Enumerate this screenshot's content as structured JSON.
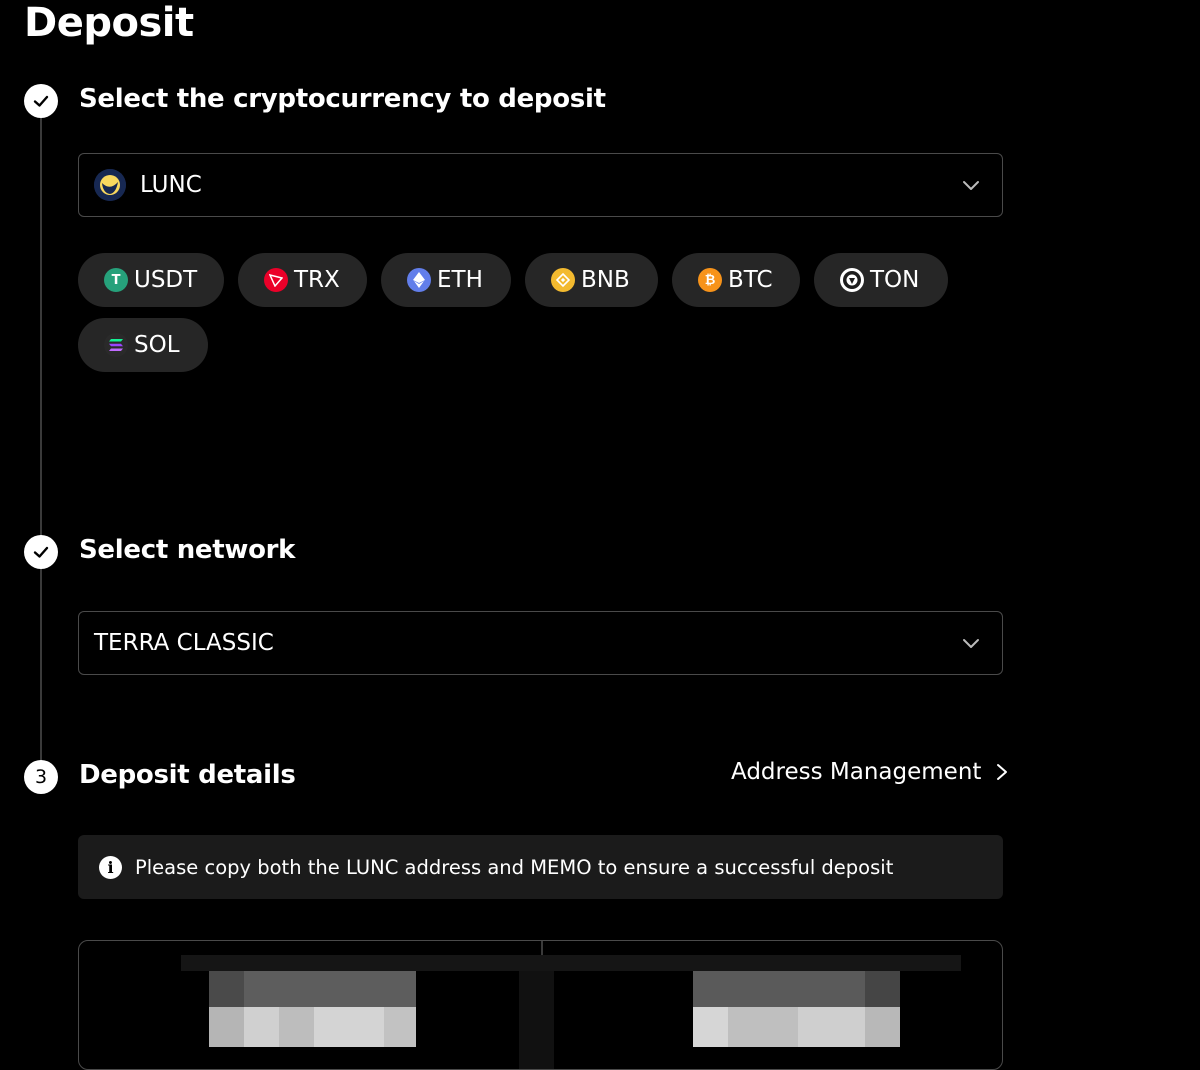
{
  "page": {
    "title": "Deposit"
  },
  "steps": [
    {
      "title": "Select the cryptocurrency to deposit",
      "marker": "check-icon"
    },
    {
      "title": "Select network",
      "marker": "check-icon"
    },
    {
      "title": "Deposit details",
      "marker": "3"
    }
  ],
  "crypto_select": {
    "value": "LUNC",
    "icon": "lunc-coin-icon"
  },
  "quick_coins": [
    {
      "label": "USDT",
      "icon": "usdt-icon",
      "color": "#26a17b"
    },
    {
      "label": "TRX",
      "icon": "trx-icon",
      "color": "#eb0029"
    },
    {
      "label": "ETH",
      "icon": "eth-icon",
      "color": "#627eea"
    },
    {
      "label": "BNB",
      "icon": "bnb-icon",
      "color": "#f3ba2f"
    },
    {
      "label": "BTC",
      "icon": "btc-icon",
      "color": "#f7931a"
    },
    {
      "label": "TON",
      "icon": "ton-icon",
      "color": "#ffffff"
    },
    {
      "label": "SOL",
      "icon": "sol-icon",
      "color": "#9945ff"
    }
  ],
  "network_select": {
    "value": "TERRA CLASSIC"
  },
  "address_management": {
    "label": "Address Management"
  },
  "notice": {
    "text": "Please copy both the LUNC address and MEMO to ensure a successful deposit"
  },
  "colors": {
    "background": "#000000",
    "chip": "#262626",
    "border": "#4a4a4a"
  }
}
